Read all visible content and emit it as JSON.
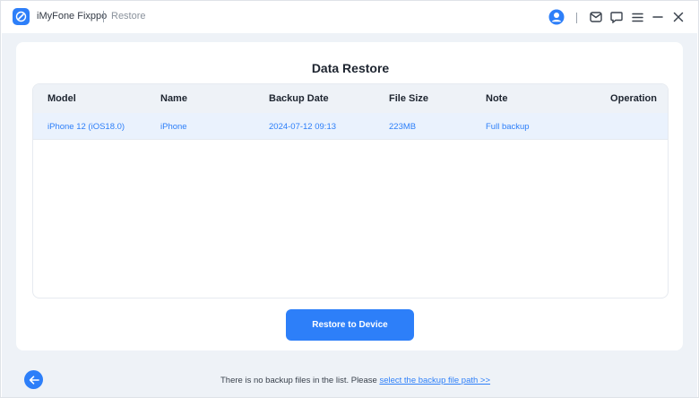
{
  "titlebar": {
    "app_name": "iMyFone Fixppo",
    "section": "Restore",
    "icons": [
      "user-avatar-icon",
      "mail-icon",
      "feedback-icon",
      "menu-icon",
      "minimize-icon",
      "close-icon"
    ]
  },
  "page": {
    "title": "Data Restore"
  },
  "table": {
    "headers": {
      "model": "Model",
      "name": "Name",
      "backup_date": "Backup Date",
      "file_size": "File Size",
      "note": "Note",
      "operation": "Operation"
    },
    "rows": [
      {
        "model": "iPhone 12 (iOS18.0)",
        "name": "iPhone",
        "backup_date": "2024-07-12 09:13",
        "file_size": "223MB",
        "note": "Full backup",
        "operation": ""
      }
    ]
  },
  "actions": {
    "restore_label": "Restore to Device"
  },
  "footer": {
    "message": "There is no backup files in the list. Please ",
    "link_label": "select the backup file path >>"
  },
  "colors": {
    "accent": "#2d7ff9",
    "background": "#eef2f7",
    "selected_row": "#eaf2fd"
  }
}
